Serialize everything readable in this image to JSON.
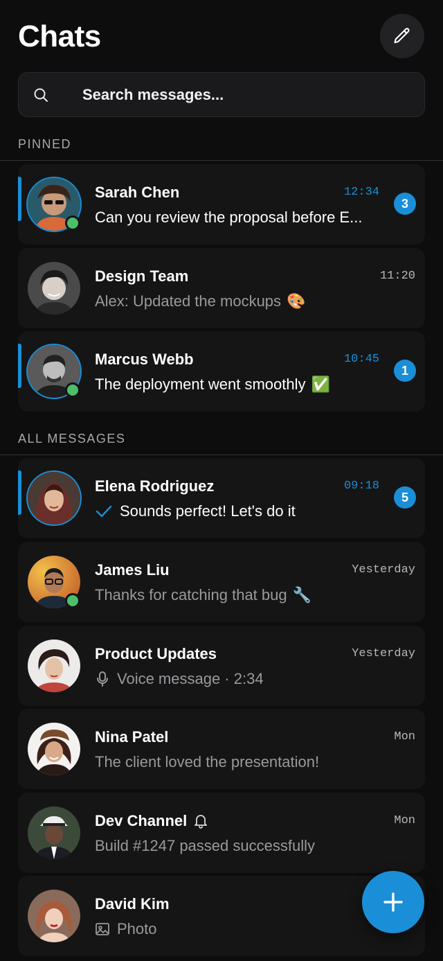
{
  "header": {
    "title": "Chats"
  },
  "search": {
    "placeholder": "Search messages..."
  },
  "sections": {
    "pinned": "PINNED",
    "all": "ALL MESSAGES"
  },
  "colors": {
    "accent": "#1a8fd8",
    "online": "#4cbf6a",
    "background": "#0d0d0d",
    "card": "#151516"
  },
  "chats": [
    {
      "name": "Sarah Chen",
      "time": "12:34",
      "preview": "Can you review the proposal before E...",
      "unread": "3",
      "online": true,
      "pinned": true
    },
    {
      "name": "Design Team",
      "time": "11:20",
      "preview": "Alex: Updated the mockups",
      "emoji": "🎨",
      "pinned": true
    },
    {
      "name": "Marcus Webb",
      "time": "10:45",
      "preview": "The deployment went smoothly",
      "emoji": "✅",
      "unread": "1",
      "online": true,
      "pinned": true
    },
    {
      "name": "Elena Rodriguez",
      "time": "09:18",
      "preview": "Sounds perfect! Let's do it",
      "unread": "5",
      "icon": "check-icon"
    },
    {
      "name": "James Liu",
      "time": "Yesterday",
      "preview": "Thanks for catching that bug",
      "emoji": "🔧",
      "online": true
    },
    {
      "name": "Product Updates",
      "time": "Yesterday",
      "preview": "Voice message · 2:34",
      "icon": "microphone-icon"
    },
    {
      "name": "Nina Patel",
      "time": "Mon",
      "preview": "The client loved the presentation!"
    },
    {
      "name": "Dev Channel",
      "time": "Mon",
      "preview": "Build #1247 passed successfully",
      "name_icon": "bell-icon"
    },
    {
      "name": "David Kim",
      "preview": "Photo",
      "icon": "image-icon"
    }
  ]
}
